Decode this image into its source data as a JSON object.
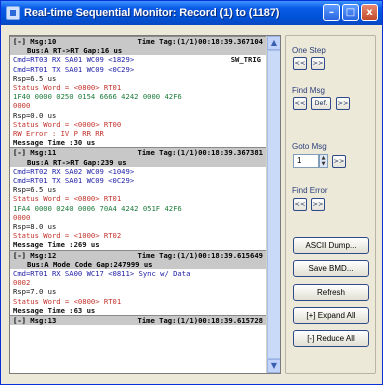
{
  "window": {
    "title": "Real-time Sequential Monitor: Record (1) to (1187)",
    "controls": {
      "minimize": "–",
      "maximize": "□",
      "close": "x"
    }
  },
  "log": {
    "records": [
      {
        "header1": "[-] Msg:10",
        "header1_right": "Time Tag:(1/1)00:18:39.367104",
        "header2": "Bus:A      RT->RT      Gap:16 us",
        "trig": "SW_TRIG",
        "lines": [
          {
            "text": "Cmd=RT03 RX SA01 WC09 <1829>",
            "color": "blue"
          },
          {
            "text": "Cmd=RT01 TX SA01 WC09 <0C29>",
            "color": "blue"
          },
          {
            "text": "Rsp=6.5 us",
            "color": "black"
          },
          {
            "text": "Status Word = <0800> RT01",
            "color": "red"
          },
          {
            "text": "1F40 0000 0250 0154 6666 4242 0000 42F6",
            "color": "green"
          },
          {
            "text": "0000",
            "color": "red"
          },
          {
            "text": "Rsp=0.0 us",
            "color": "black"
          },
          {
            "text": "Status Word = <0000> RT00",
            "color": "red"
          },
          {
            "text": "RW Error : IV P RR RR",
            "color": "red"
          },
          {
            "text": "Message Time :30 us",
            "color": "bold"
          }
        ]
      },
      {
        "header1": "[-] Msg:11",
        "header1_right": "Time Tag:(1/1)00:18:39.367381",
        "header2": "Bus:A      RT->RT      Gap:239 us",
        "trig": "",
        "lines": [
          {
            "text": "Cmd=RT02 RX SA02 WC09 <1049>",
            "color": "blue"
          },
          {
            "text": "Cmd=RT01 TX SA01 WC09 <0C29>",
            "color": "blue"
          },
          {
            "text": "Rsp=6.5 us",
            "color": "black"
          },
          {
            "text": "Status Word = <0800> RT01",
            "color": "red"
          },
          {
            "text": "1FA4 0000 0240 0006 70A4 4242 051F 42F6",
            "color": "green"
          },
          {
            "text": "0000",
            "color": "red"
          },
          {
            "text": "Rsp=8.0 us",
            "color": "black"
          },
          {
            "text": "Status Word = <1000> RT02",
            "color": "red"
          },
          {
            "text": "Message Time :269 us",
            "color": "bold"
          }
        ]
      },
      {
        "header1": "[-] Msg:12",
        "header1_right": "Time Tag:(1/1)00:18:39.615649",
        "header2": "Bus:A      Mode Code    Gap:247999 us",
        "trig": "",
        "lines": [
          {
            "text": "Cmd=RT01 RX SA00 WC17 <0811> Sync w/ Data",
            "color": "blue"
          },
          {
            "text": "0002",
            "color": "red"
          },
          {
            "text": "Rsp=7.0 us",
            "color": "black"
          },
          {
            "text": "Status Word = <0800> RT01",
            "color": "red"
          },
          {
            "text": "Message Time :63 us",
            "color": "bold"
          }
        ]
      },
      {
        "header1": "[-] Msg:13",
        "header1_right": "Time Tag:(1/1)00:18:39.615728",
        "header2": "",
        "trig": "",
        "lines": []
      }
    ]
  },
  "panel": {
    "one_step": {
      "label": "One Step",
      "prev": "<<",
      "next": ">>"
    },
    "find_msg": {
      "label": "Find Msg",
      "prev": "<<",
      "def": "Def.",
      "next": ">>"
    },
    "goto_msg": {
      "label": "Goto Msg",
      "value": "1",
      "up": "▲",
      "down": "▼",
      "next": ">>"
    },
    "find_error": {
      "label": "Find Error",
      "prev": "<<",
      "next": ">>"
    },
    "buttons": {
      "ascii_dump": "ASCII Dump...",
      "save_bmd": "Save BMD...",
      "refresh": "Refresh",
      "expand_all": "[+] Expand All",
      "reduce_all": "[-] Reduce All"
    }
  },
  "colors": {
    "titlebar": "#0a5ae6",
    "blue_text": "#2020a8",
    "green_text": "#1b7a3a",
    "red_text": "#c2312a",
    "header_bg": "#c8c8c8"
  }
}
